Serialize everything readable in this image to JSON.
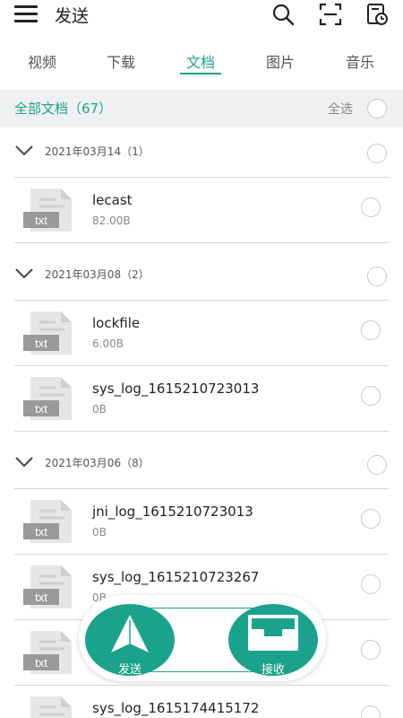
{
  "header": {
    "title": "发送",
    "icons": [
      "menu-icon",
      "search-icon",
      "scan-icon",
      "history-icon"
    ]
  },
  "tabs": [
    {
      "label": "视频",
      "active": false
    },
    {
      "label": "下载",
      "active": false
    },
    {
      "label": "文档",
      "active": true
    },
    {
      "label": "图片",
      "active": false
    },
    {
      "label": "音乐",
      "active": false
    }
  ],
  "summary": {
    "title": "全部文档（67）",
    "select_all": "全选"
  },
  "groups": [
    {
      "label": "2021年03月14（1）",
      "files": [
        {
          "name": "lecast",
          "size": "82.00B",
          "badge": "txt"
        }
      ]
    },
    {
      "label": "2021年03月08（2）",
      "files": [
        {
          "name": "lockfile",
          "size": "6.00B",
          "badge": "txt"
        },
        {
          "name": "sys_log_1615210723013",
          "size": "0B",
          "badge": "txt"
        }
      ]
    },
    {
      "label": "2021年03月06（8）",
      "files": [
        {
          "name": "jni_log_1615210723013",
          "size": "0B",
          "badge": "txt"
        },
        {
          "name": "sys_log_1615210723267",
          "size": "0B",
          "badge": "txt"
        },
        {
          "name": "",
          "size": "",
          "badge": "txt"
        },
        {
          "name": "sys_log_1615174415172",
          "size": "",
          "badge": "txt"
        }
      ]
    }
  ],
  "actions": {
    "send_label": "发送",
    "receive_label": "接收"
  },
  "colors": {
    "accent": "#1aa38a",
    "badge": "#9a9a9a"
  }
}
